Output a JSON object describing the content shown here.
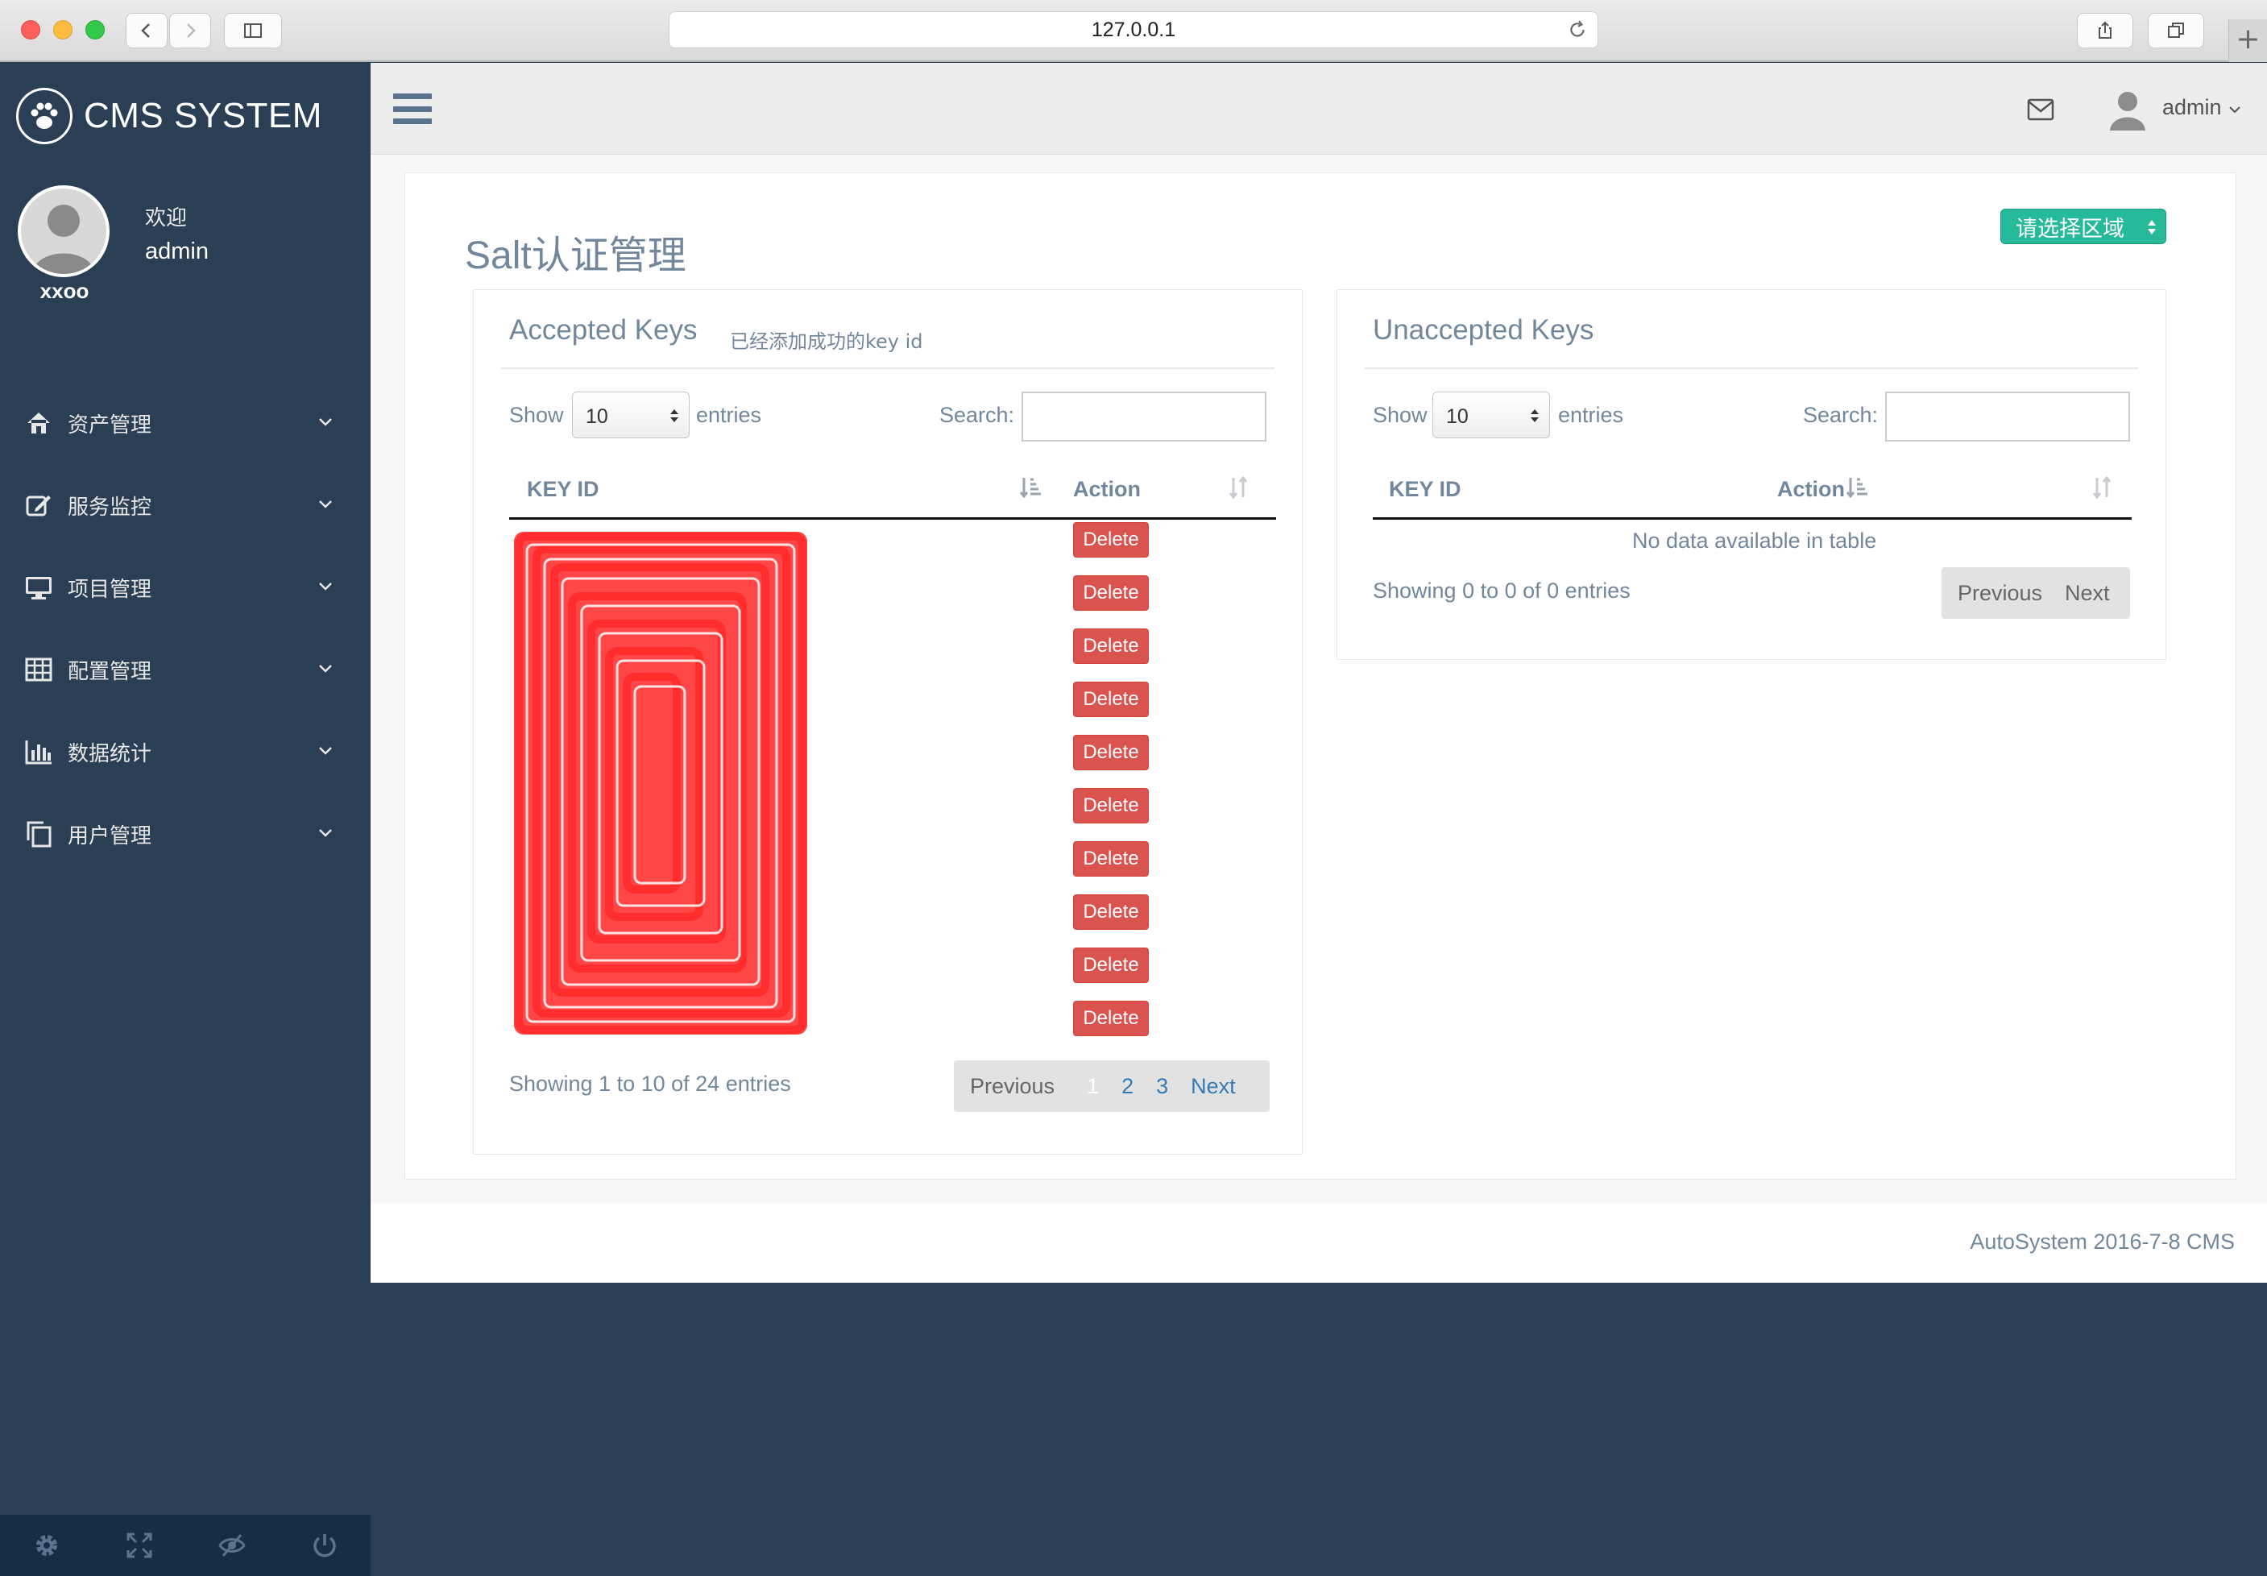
{
  "browser": {
    "url": "127.0.0.1",
    "new_tab_label": "+"
  },
  "brand": {
    "name": "CMS SYSTEM",
    "icon": "paw-icon"
  },
  "profile": {
    "welcome": "欢迎",
    "username": "admin",
    "caption": "xxoo"
  },
  "sidebar": {
    "items": [
      {
        "label": "资产管理",
        "icon": "home-icon"
      },
      {
        "label": "服务监控",
        "icon": "edit-icon"
      },
      {
        "label": "项目管理",
        "icon": "desktop-icon"
      },
      {
        "label": "配置管理",
        "icon": "table-icon"
      },
      {
        "label": "数据统计",
        "icon": "bar-chart-icon"
      },
      {
        "label": "用户管理",
        "icon": "clone-icon"
      }
    ],
    "footer_icons": [
      "gear-icon",
      "fullscreen-icon",
      "eye-slash-icon",
      "power-icon"
    ]
  },
  "topnav": {
    "user": "admin"
  },
  "page": {
    "title": "Salt认证管理",
    "region_select": "请选择区域"
  },
  "accepted": {
    "title": "Accepted Keys",
    "subtitle": "已经添加成功的key id",
    "show": "Show",
    "length": "10",
    "entries": "entries",
    "search": "Search:",
    "col_key": "KEY ID",
    "col_action": "Action",
    "delete_label": "Delete",
    "rows": [
      "",
      "",
      "",
      "",
      "",
      "",
      "",
      "",
      "",
      ""
    ],
    "info": "Showing 1 to 10 of 24 entries",
    "pager": {
      "prev": "Previous",
      "p1": "1",
      "p2": "2",
      "p3": "3",
      "next": "Next"
    }
  },
  "unaccepted": {
    "title": "Unaccepted Keys",
    "show": "Show",
    "length": "10",
    "entries": "entries",
    "search": "Search:",
    "col_key": "KEY ID",
    "col_action": "Action",
    "empty": "No data available in table",
    "info": "Showing 0 to 0 of 0 entries",
    "pager": {
      "prev": "Previous",
      "next": "Next"
    }
  },
  "footer": {
    "text": "AutoSystem 2016-7-8 CMS"
  },
  "colors": {
    "sidebar": "#2a3f54",
    "danger": "#d9534f",
    "success": "#26b99a",
    "redaction": "#ff2d2d"
  }
}
